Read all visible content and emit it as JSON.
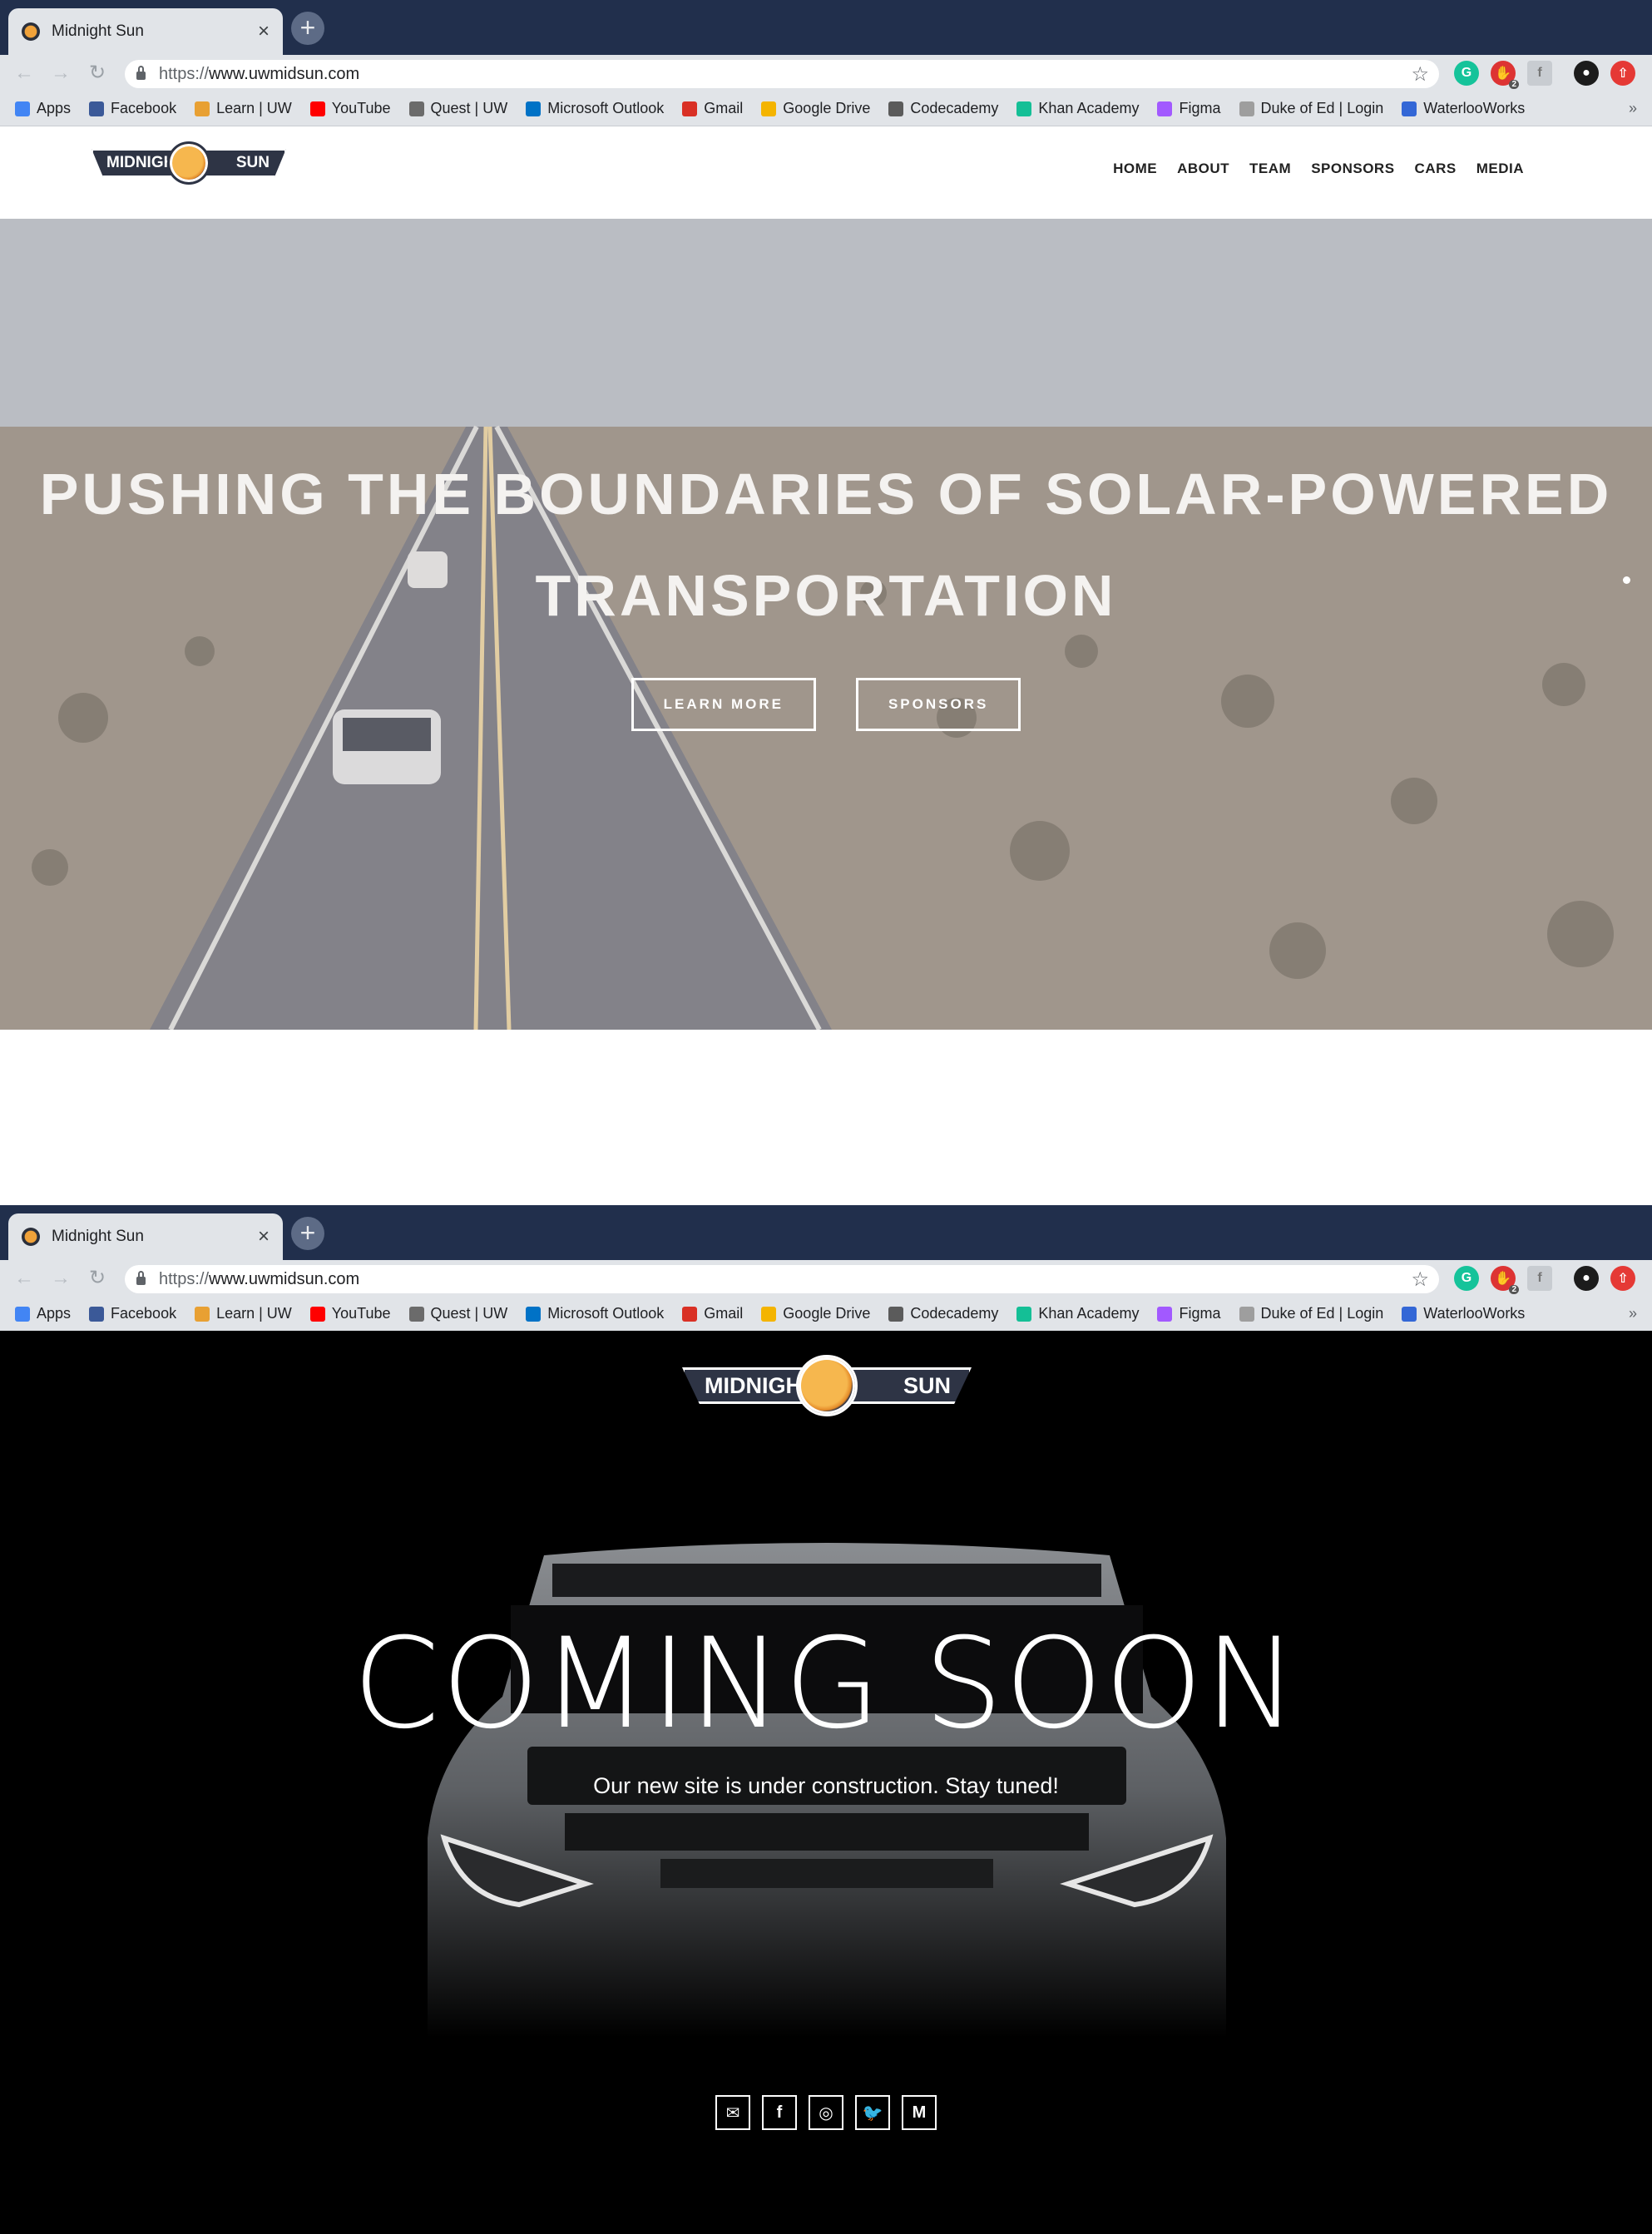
{
  "browser": {
    "tab_title": "Midnight Sun",
    "tab_close": "×",
    "new_tab": "+",
    "url_scheme": "https://",
    "url_host": "www.uwmidsun.com",
    "adblock_badge": "2",
    "bookmarks": [
      {
        "label": "Apps",
        "icon": "apps-grid-icon",
        "color": "#4285f4"
      },
      {
        "label": "Facebook",
        "icon": "facebook-icon",
        "color": "#3b5998"
      },
      {
        "label": "Learn | UW",
        "icon": "learn-uw-icon",
        "color": "#e8a033"
      },
      {
        "label": "YouTube",
        "icon": "youtube-icon",
        "color": "#ff0000"
      },
      {
        "label": "Quest | UW",
        "icon": "quest-icon",
        "color": "#6b6b6b"
      },
      {
        "label": "Microsoft Outlook",
        "icon": "outlook-icon",
        "color": "#0072c6"
      },
      {
        "label": "Gmail",
        "icon": "gmail-icon",
        "color": "#d93025"
      },
      {
        "label": "Google Drive",
        "icon": "google-drive-icon",
        "color": "#f4b400"
      },
      {
        "label": "Codecademy",
        "icon": "codecademy-icon",
        "color": "#5b5b5b"
      },
      {
        "label": "Khan Academy",
        "icon": "khan-academy-icon",
        "color": "#14bf96"
      },
      {
        "label": "Figma",
        "icon": "figma-icon",
        "color": "#a259ff"
      },
      {
        "label": "Duke of Ed | Login",
        "icon": "duke-of-ed-icon",
        "color": "#9e9e9e"
      },
      {
        "label": "WaterlooWorks",
        "icon": "waterlooworks-icon",
        "color": "#3367d6"
      }
    ],
    "bookmarks_more": "»"
  },
  "site1": {
    "logo_left": "MIDNIGHT",
    "logo_right": "SUN",
    "nav": [
      "HOME",
      "ABOUT",
      "TEAM",
      "SPONSORS",
      "CARS",
      "MEDIA"
    ],
    "hero_line1": "PUSHING THE BOUNDARIES OF SOLAR-POWERED",
    "hero_line2": "TRANSPORTATION",
    "btn_learn": "LEARN MORE",
    "btn_sponsors": "SPONSORS"
  },
  "site2": {
    "logo_left": "MIDNIGHT",
    "logo_right": "SUN",
    "title": "COMING SOON",
    "subtitle": "Our new site is under construction. Stay tuned!",
    "socials": [
      {
        "name": "email-icon",
        "glyph": "✉"
      },
      {
        "name": "facebook-icon",
        "glyph": "f"
      },
      {
        "name": "instagram-icon",
        "glyph": "◎"
      },
      {
        "name": "twitter-icon",
        "glyph": "🐦"
      },
      {
        "name": "medium-icon",
        "glyph": "M"
      }
    ]
  },
  "colors": {
    "tabstrip": "#212f4c",
    "chrome": "#e1e4e8",
    "logo_dark": "#2e3445",
    "sun_orange": "#f0a23a"
  }
}
